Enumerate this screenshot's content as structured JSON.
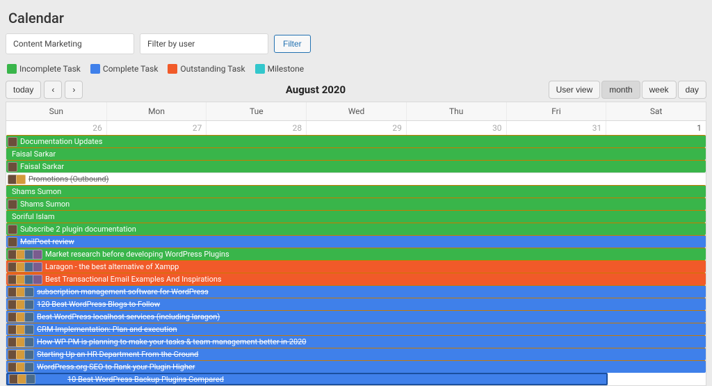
{
  "title": "Calendar",
  "filters": {
    "project": "Content Marketing",
    "user": "Filter by user",
    "button": "Filter"
  },
  "legend": {
    "incomplete": "Incomplete Task",
    "complete": "Complete Task",
    "outstanding": "Outstanding Task",
    "milestone": "Milestone"
  },
  "toolbar": {
    "today": "today",
    "prev": "‹",
    "next": "›",
    "period": "August 2020",
    "views": {
      "user": "User view",
      "month": "month",
      "week": "week",
      "day": "day"
    }
  },
  "weekdays": [
    "Sun",
    "Mon",
    "Tue",
    "Wed",
    "Thu",
    "Fri",
    "Sat"
  ],
  "dates": [
    {
      "n": "26",
      "current": false
    },
    {
      "n": "27",
      "current": false
    },
    {
      "n": "28",
      "current": false
    },
    {
      "n": "29",
      "current": false
    },
    {
      "n": "30",
      "current": false
    },
    {
      "n": "31",
      "current": false
    },
    {
      "n": "1",
      "current": true
    }
  ],
  "events": [
    {
      "status": "incomplete",
      "avatars": 1,
      "strike": false,
      "label": "Documentation Updates"
    },
    {
      "status": "incomplete",
      "avatars": 0,
      "strike": false,
      "label": "Faisal Sarkar"
    },
    {
      "status": "incomplete",
      "avatars": 1,
      "strike": false,
      "label": "Faisal Sarkar"
    },
    {
      "status": "placeholder",
      "avatars": 2,
      "strike": true,
      "label": "Promotions (Outbound)"
    },
    {
      "status": "incomplete",
      "avatars": 0,
      "strike": false,
      "label": "Shams Sumon"
    },
    {
      "status": "incomplete",
      "avatars": 1,
      "strike": false,
      "label": "Shams Sumon"
    },
    {
      "status": "incomplete",
      "avatars": 0,
      "strike": false,
      "label": "Soriful Islam"
    },
    {
      "status": "incomplete",
      "avatars": 1,
      "strike": false,
      "label": "Subscribe 2 plugin documentation"
    },
    {
      "status": "complete",
      "avatars": 1,
      "strike": true,
      "label": "MailPoet review"
    },
    {
      "status": "incomplete",
      "avatars": 4,
      "strike": false,
      "label": "Market research before developing WordPress Plugins"
    },
    {
      "status": "outstanding",
      "avatars": 4,
      "strike": false,
      "label": "Laragon - the best alternative of Xampp"
    },
    {
      "status": "outstanding",
      "avatars": 4,
      "strike": false,
      "label": "Best Transactional Email Examples And Inspirations"
    },
    {
      "status": "complete",
      "avatars": 3,
      "strike": true,
      "label": "subscription management software for WordPress"
    },
    {
      "status": "complete",
      "avatars": 3,
      "strike": true,
      "label": "120 Best WordPress Blogs to Follow"
    },
    {
      "status": "complete",
      "avatars": 3,
      "strike": true,
      "label": "Best WordPress localhost services (including laragon)"
    },
    {
      "status": "complete",
      "avatars": 3,
      "strike": true,
      "label": "CRM Implementation: Plan and execution"
    },
    {
      "status": "complete",
      "avatars": 3,
      "strike": true,
      "label": "How WP PM is planning to make your tasks & team management better in 2020"
    },
    {
      "status": "complete",
      "avatars": 3,
      "strike": true,
      "label": "Starting Up an HR Department From the Ground"
    },
    {
      "status": "complete",
      "avatars": 3,
      "strike": true,
      "label": "WordPress.org SEO to Rank your Plugin Higher"
    },
    {
      "status": "complete",
      "avatars": 3,
      "strike": true,
      "label": "10 Best WordPress Backup Plugins Compared",
      "short": true
    }
  ]
}
